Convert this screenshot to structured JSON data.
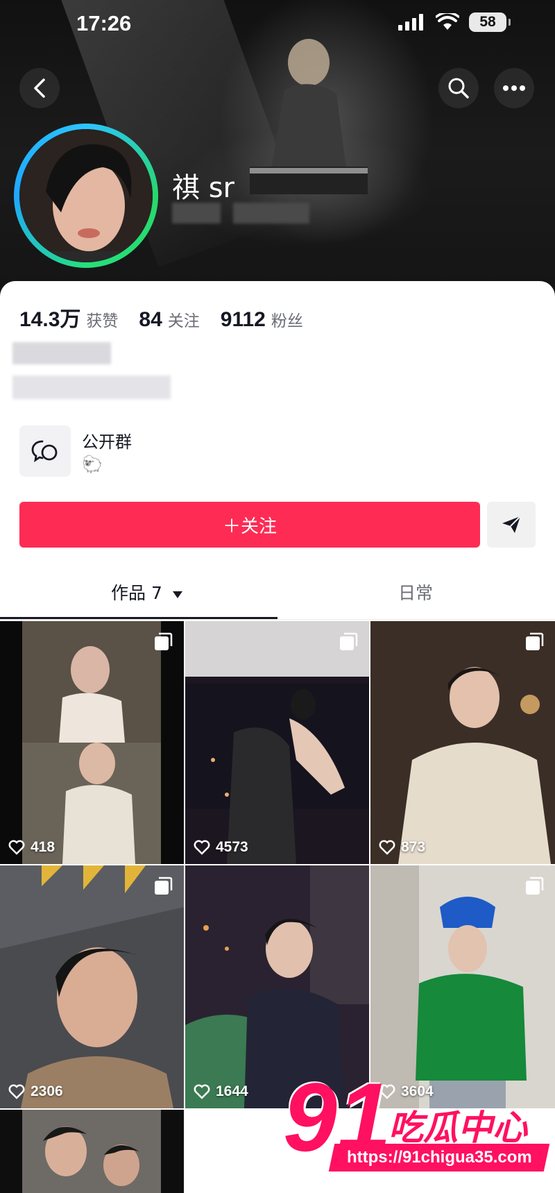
{
  "status_bar": {
    "time": "17:26",
    "battery": "58"
  },
  "profile": {
    "nickname": "祺 sr"
  },
  "stats": [
    {
      "value": "14.3万",
      "label": "获赞"
    },
    {
      "value": "84",
      "label": "关注"
    },
    {
      "value": "9112",
      "label": "粉丝"
    }
  ],
  "group": {
    "title": "公开群",
    "emoji": "🐑"
  },
  "actions": {
    "follow": "＋关注"
  },
  "tabs": {
    "works_label": "作品 7",
    "daily_label": "日常"
  },
  "videos": [
    {
      "likes": "418"
    },
    {
      "likes": "4573"
    },
    {
      "likes": "873"
    },
    {
      "likes": "2306"
    },
    {
      "likes": "1644"
    },
    {
      "likes": "3604"
    },
    {
      "likes": ""
    }
  ],
  "watermark": {
    "number": "91",
    "text": "吃瓜中心",
    "url": "https://91chigua35.com"
  },
  "colors": {
    "accent": "#fe2c55",
    "watermark": "#ff1060"
  }
}
